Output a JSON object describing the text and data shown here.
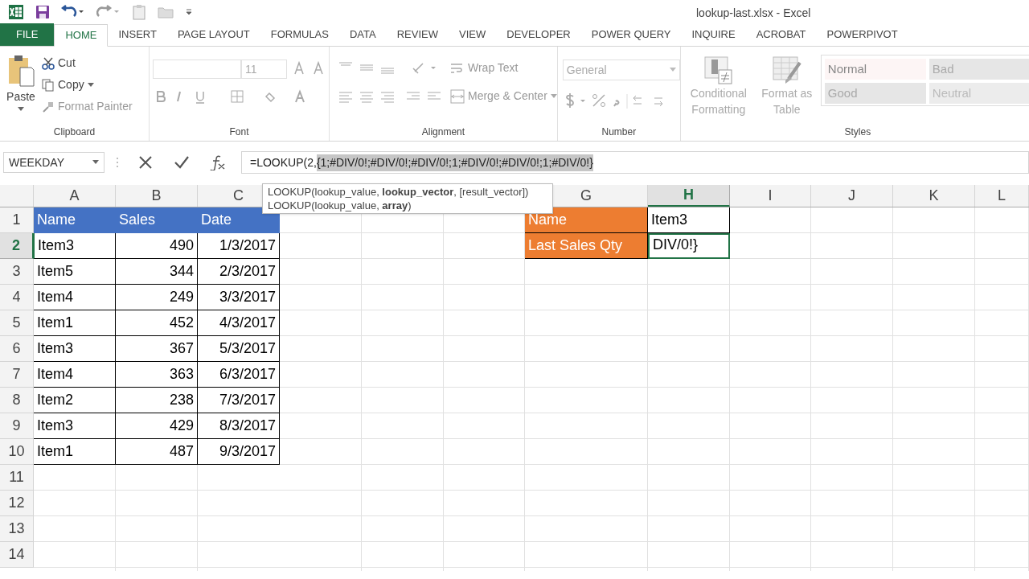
{
  "window": {
    "title": "lookup-last.xlsx - Excel"
  },
  "tabs": [
    {
      "label": "FILE",
      "kind": "file",
      "selected": false
    },
    {
      "label": "HOME",
      "kind": "tab",
      "selected": true
    },
    {
      "label": "INSERT",
      "kind": "tab",
      "selected": false
    },
    {
      "label": "PAGE LAYOUT",
      "kind": "tab",
      "selected": false
    },
    {
      "label": "FORMULAS",
      "kind": "tab",
      "selected": false
    },
    {
      "label": "DATA",
      "kind": "tab",
      "selected": false
    },
    {
      "label": "REVIEW",
      "kind": "tab",
      "selected": false
    },
    {
      "label": "VIEW",
      "kind": "tab",
      "selected": false
    },
    {
      "label": "DEVELOPER",
      "kind": "tab",
      "selected": false
    },
    {
      "label": "POWER QUERY",
      "kind": "tab",
      "selected": false
    },
    {
      "label": "INQUIRE",
      "kind": "tab",
      "selected": false
    },
    {
      "label": "ACROBAT",
      "kind": "tab",
      "selected": false
    },
    {
      "label": "POWERPIVOT",
      "kind": "tab",
      "selected": false
    }
  ],
  "ribbon": {
    "clipboard": {
      "paste": "Paste",
      "cut": "Cut",
      "copy": "Copy",
      "format_painter": "Format Painter",
      "label": "Clipboard"
    },
    "font": {
      "size": "11",
      "label": "Font"
    },
    "alignment": {
      "wrap_text": "Wrap Text",
      "merge_center": "Merge & Center",
      "label": "Alignment"
    },
    "number": {
      "format": "General",
      "label": "Number"
    },
    "styles": {
      "conditional": [
        "Conditional",
        "Formatting"
      ],
      "format_table": [
        "Format as",
        "Table"
      ],
      "cell_styles": [
        "Normal",
        "Bad",
        "Good",
        "Neutral"
      ],
      "label": "Styles"
    }
  },
  "formula_bar": {
    "name_box": "WEEKDAY",
    "formula_prefix": "=LOOKUP(2,",
    "formula_selected": "{1;#DIV/0!;#DIV/0!;#DIV/0!;1;#DIV/0!;#DIV/0!;1;#DIV/0!}"
  },
  "tooltip": {
    "lines": [
      "LOOKUP(lookup_value, **lookup_vector**, [result_vector])",
      "LOOKUP(lookup_value, **array**)"
    ]
  },
  "grid": {
    "columns": [
      {
        "label": "A",
        "selected": false
      },
      {
        "label": "B",
        "selected": false
      },
      {
        "label": "C",
        "selected": false
      },
      {
        "label": "G",
        "selected": false
      },
      {
        "label": "H",
        "selected": true
      },
      {
        "label": "I",
        "selected": false
      },
      {
        "label": "J",
        "selected": false
      },
      {
        "label": "K",
        "selected": false
      },
      {
        "label": "L",
        "selected": false
      }
    ],
    "rows": [
      {
        "label": "1",
        "selected": false
      },
      {
        "label": "2",
        "selected": true
      },
      {
        "label": "3",
        "selected": false
      },
      {
        "label": "4",
        "selected": false
      },
      {
        "label": "5",
        "selected": false
      },
      {
        "label": "6",
        "selected": false
      },
      {
        "label": "7",
        "selected": false
      },
      {
        "label": "8",
        "selected": false
      },
      {
        "label": "9",
        "selected": false
      },
      {
        "label": "10",
        "selected": false
      },
      {
        "label": "11",
        "selected": false
      },
      {
        "label": "12",
        "selected": false
      },
      {
        "label": "13",
        "selected": false
      },
      {
        "label": "14",
        "selected": false
      }
    ]
  },
  "table": {
    "columns": [
      {
        "label": "Name",
        "kind": "text"
      },
      {
        "label": "Sales",
        "kind": "number"
      },
      {
        "label": "Date",
        "kind": "number"
      }
    ],
    "rows": [
      [
        "Item3",
        "490",
        "1/3/2017"
      ],
      [
        "Item5",
        "344",
        "2/3/2017"
      ],
      [
        "Item4",
        "249",
        "3/3/2017"
      ],
      [
        "Item1",
        "452",
        "4/3/2017"
      ],
      [
        "Item3",
        "367",
        "5/3/2017"
      ],
      [
        "Item4",
        "363",
        "6/3/2017"
      ],
      [
        "Item2",
        "238",
        "7/3/2017"
      ],
      [
        "Item3",
        "429",
        "8/3/2017"
      ],
      [
        "Item1",
        "487",
        "9/3/2017"
      ]
    ]
  },
  "lookup": [
    {
      "label": "Name",
      "value": "Item3",
      "active": false
    },
    {
      "label": "Last Sales Qty",
      "value": "DIV/0!}",
      "active": true
    }
  ]
}
